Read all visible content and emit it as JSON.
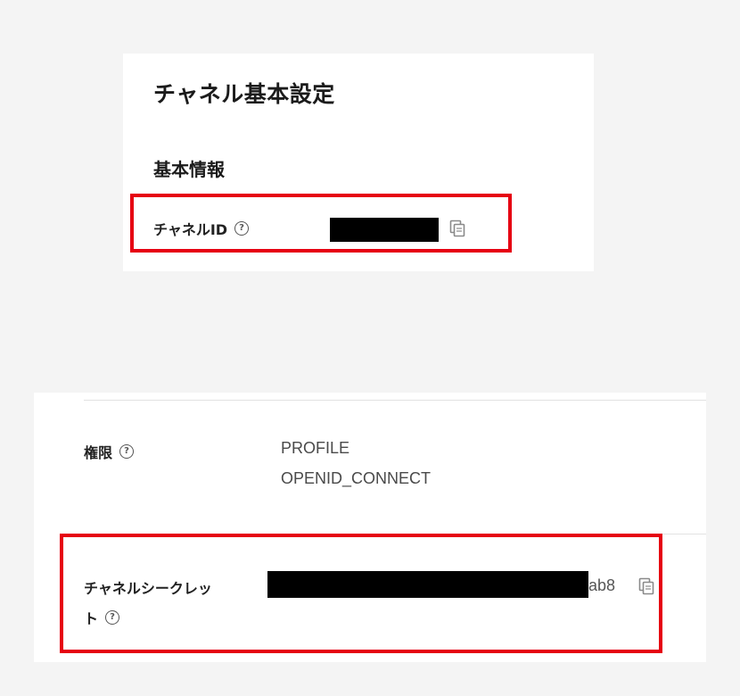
{
  "basic_settings": {
    "page_title": "チャネル基本設定",
    "section_title": "基本情報",
    "channel_id": {
      "label": "チャネルID",
      "value_redacted": true
    }
  },
  "details": {
    "permissions": {
      "label": "権限",
      "values": [
        "PROFILE",
        "OPENID_CONNECT"
      ]
    },
    "channel_secret": {
      "label_line1": "チャネルシークレッ",
      "label_line2": "ト",
      "value_visible_suffix": "ab8",
      "value_redacted": true
    }
  },
  "icons": {
    "help": "question-circle-icon",
    "copy": "copy-icon"
  },
  "colors": {
    "highlight": "#e60012",
    "background": "#f4f4f4",
    "panel": "#ffffff"
  }
}
